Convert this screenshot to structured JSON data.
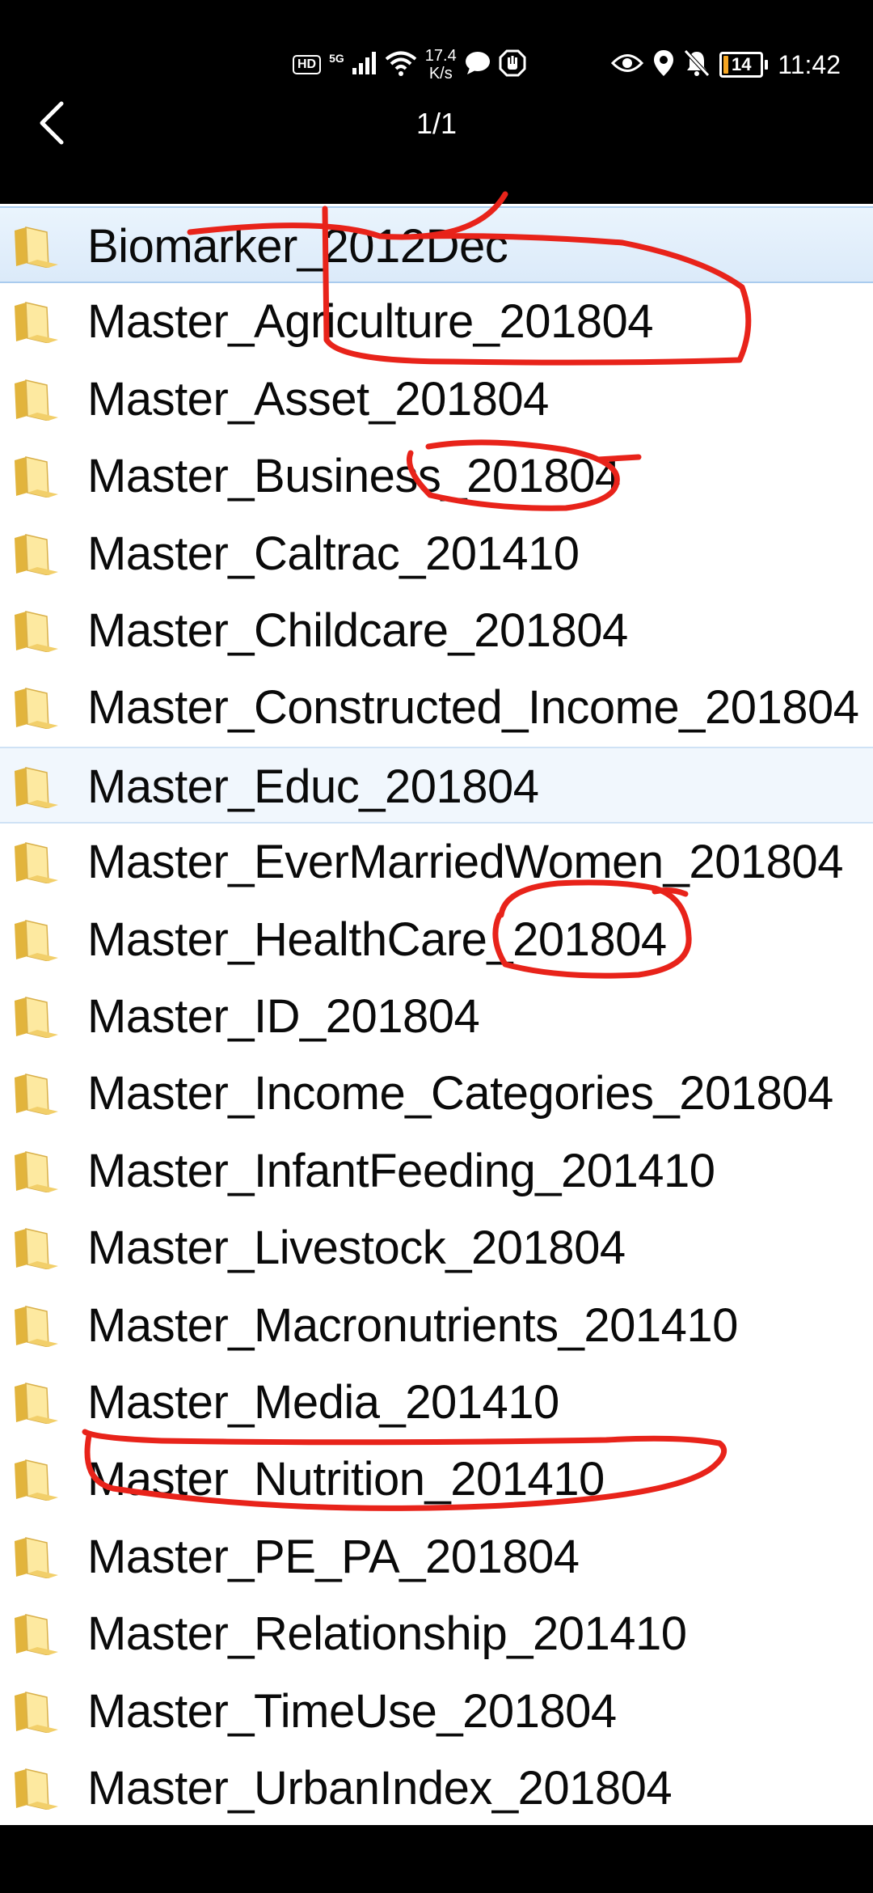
{
  "status_bar": {
    "hd_badge": "HD",
    "network_type": "5G",
    "speed_value": "17.4",
    "speed_unit": "K/s",
    "battery_level": "14",
    "time": "11:42",
    "icons": [
      "signal-icon",
      "wifi-icon",
      "message-icon",
      "hand-icon",
      "eye-icon",
      "location-icon",
      "mute-icon",
      "battery-icon"
    ]
  },
  "header": {
    "back_icon": "chevron-left-icon",
    "page_indicator": "1/1"
  },
  "files": [
    {
      "name": "Biomarker_2012Dec"
    },
    {
      "name": "Master_Agriculture_201804"
    },
    {
      "name": "Master_Asset_201804"
    },
    {
      "name": "Master_Business_201804"
    },
    {
      "name": "Master_Caltrac_201410"
    },
    {
      "name": "Master_Childcare_201804"
    },
    {
      "name": "Master_Constructed_Income_201804"
    },
    {
      "name": "Master_Educ_201804"
    },
    {
      "name": "Master_EverMarriedWomen_201804"
    },
    {
      "name": "Master_HealthCare_201804"
    },
    {
      "name": "Master_ID_201804"
    },
    {
      "name": "Master_Income_Categories_201804"
    },
    {
      "name": "Master_InfantFeeding_201410"
    },
    {
      "name": "Master_Livestock_201804"
    },
    {
      "name": "Master_Macronutrients_201410"
    },
    {
      "name": "Master_Media_201410"
    },
    {
      "name": "Master_Nutrition_201410"
    },
    {
      "name": "Master_PE_PA_201804"
    },
    {
      "name": "Master_Relationship_201410"
    },
    {
      "name": "Master_TimeUse_201804"
    },
    {
      "name": "Master_UrbanIndex_201804"
    }
  ],
  "colors": {
    "annotation": "#e8231a",
    "folder_light": "#fde9a0",
    "folder_dark": "#e2b43c",
    "selection": "#dbeaf9"
  }
}
